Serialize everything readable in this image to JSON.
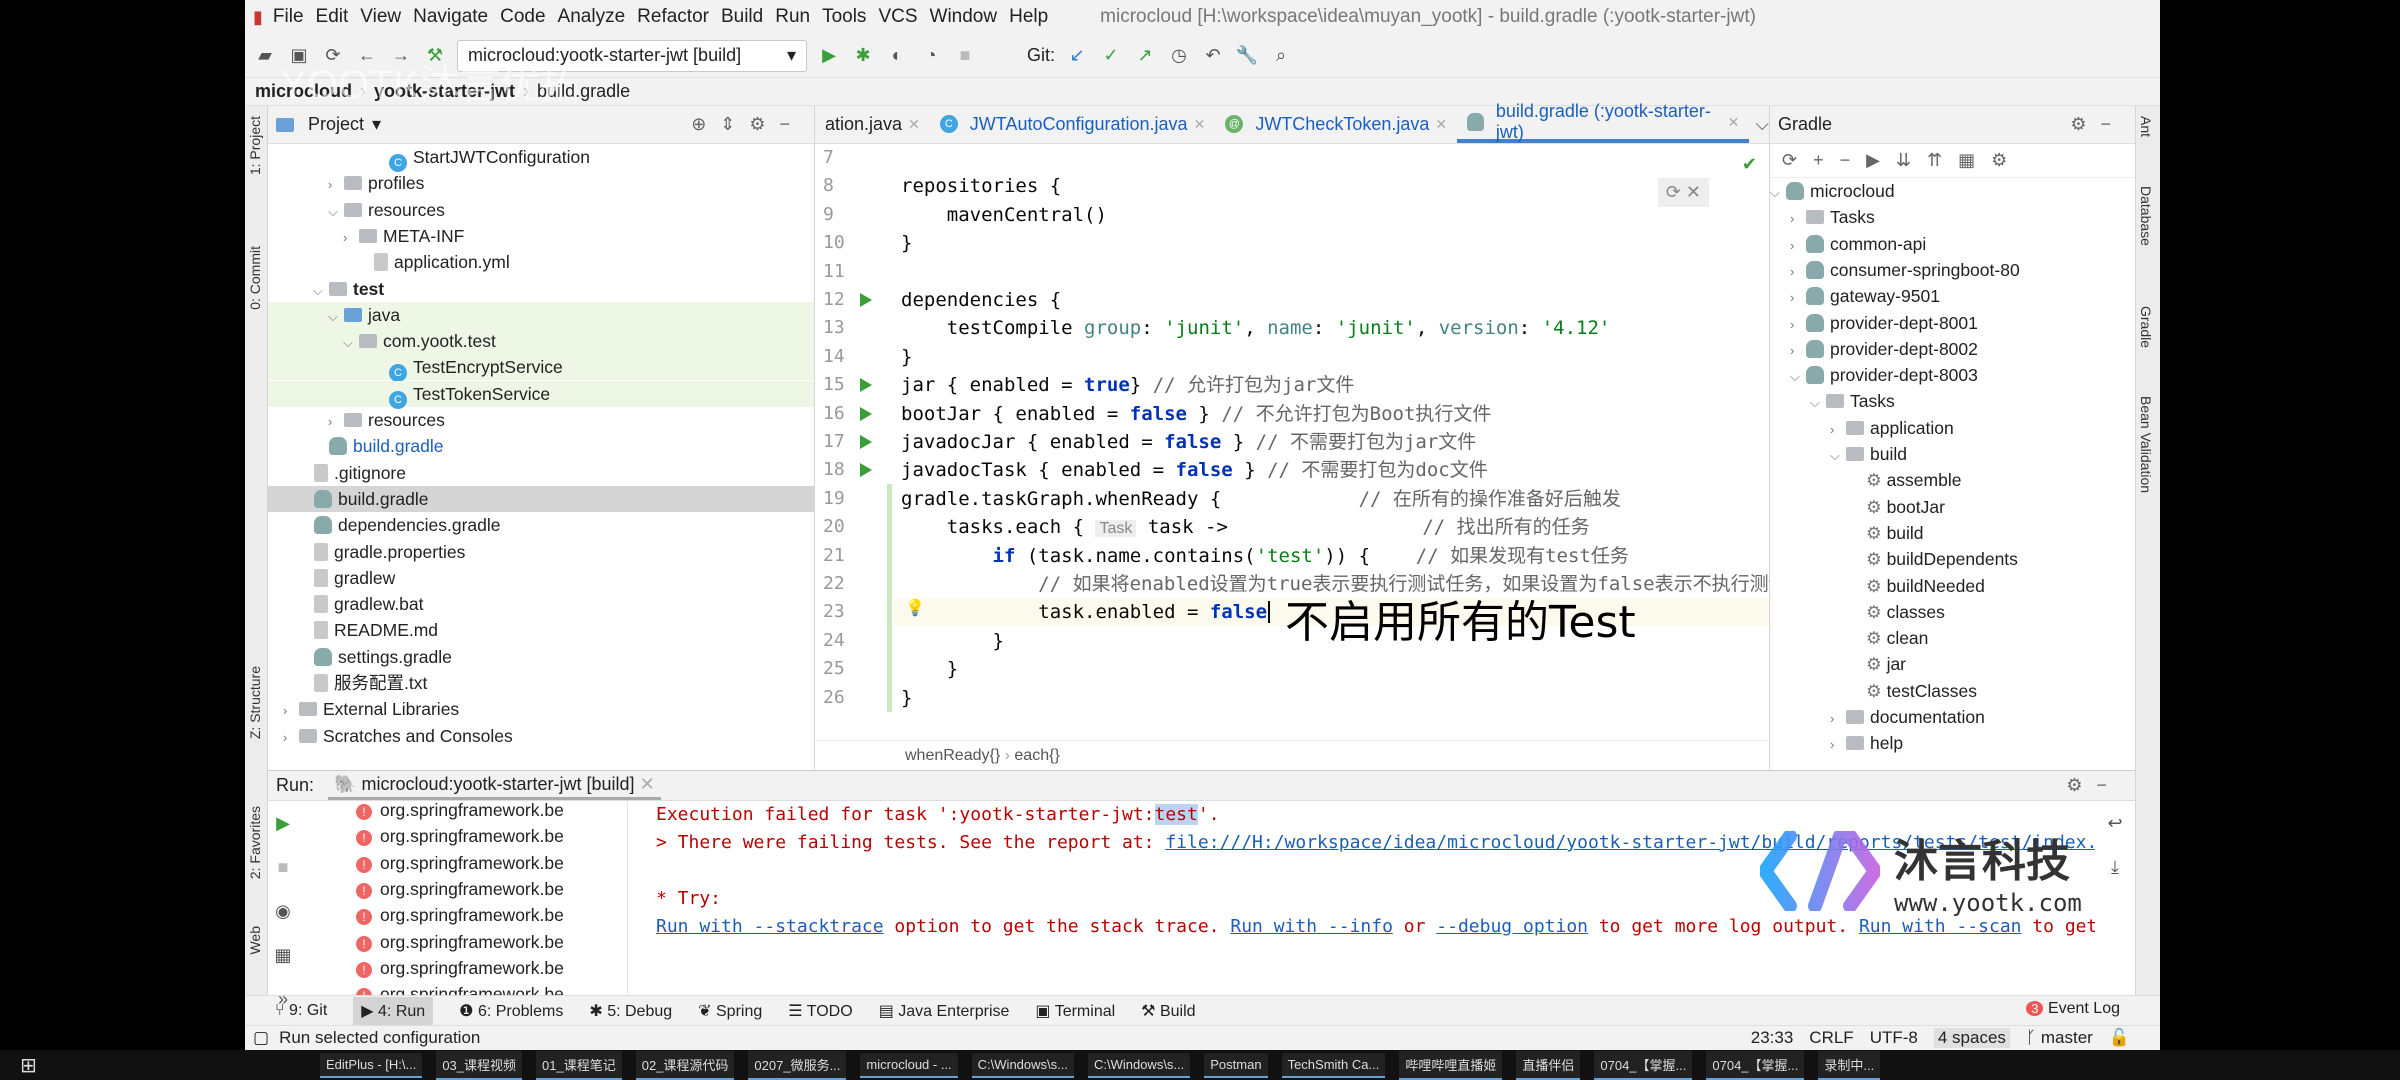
{
  "menu": {
    "items": [
      "File",
      "Edit",
      "View",
      "Navigate",
      "Code",
      "Analyze",
      "Refactor",
      "Build",
      "Run",
      "Tools",
      "VCS",
      "Window",
      "Help"
    ],
    "window_title": "microcloud [H:\\workspace\\idea\\muyan_yootk] - build.gradle (:yootk-starter-jwt)"
  },
  "toolbar": {
    "run_config": "microcloud:yootk-starter-jwt [build]",
    "git_label": "Git:"
  },
  "breadcrumb": [
    "microcloud",
    "yootk-starter-jwt",
    "build.gradle"
  ],
  "project": {
    "title": "Project",
    "rows": [
      {
        "label": "StartJWTConfiguration",
        "indent": 7,
        "icon": "class"
      },
      {
        "label": "profiles",
        "indent": 4,
        "icon": "folder",
        "arrow": "right"
      },
      {
        "label": "resources",
        "indent": 4,
        "icon": "folder",
        "arrow": "down"
      },
      {
        "label": "META-INF",
        "indent": 5,
        "icon": "folder",
        "arrow": "right"
      },
      {
        "label": "application.yml",
        "indent": 6,
        "icon": "file"
      },
      {
        "label": "test",
        "indent": 3,
        "icon": "folder",
        "arrow": "down",
        "bold": true
      },
      {
        "label": "java",
        "indent": 4,
        "icon": "src",
        "arrow": "down",
        "hl": true
      },
      {
        "label": "com.yootk.test",
        "indent": 5,
        "icon": "folder",
        "arrow": "down",
        "hl": true
      },
      {
        "label": "TestEncryptService",
        "indent": 7,
        "icon": "class",
        "hl": true
      },
      {
        "label": "TestTokenService",
        "indent": 7,
        "icon": "class",
        "hl": true
      },
      {
        "label": "resources",
        "indent": 4,
        "icon": "folder",
        "arrow": "right"
      },
      {
        "label": "build.gradle",
        "indent": 3,
        "icon": "gradle",
        "blue": true
      },
      {
        "label": ".gitignore",
        "indent": 2,
        "icon": "file"
      },
      {
        "label": "build.gradle",
        "indent": 2,
        "icon": "gradle",
        "selected": true
      },
      {
        "label": "dependencies.gradle",
        "indent": 2,
        "icon": "gradle"
      },
      {
        "label": "gradle.properties",
        "indent": 2,
        "icon": "file"
      },
      {
        "label": "gradlew",
        "indent": 2,
        "icon": "file"
      },
      {
        "label": "gradlew.bat",
        "indent": 2,
        "icon": "file"
      },
      {
        "label": "README.md",
        "indent": 2,
        "icon": "file"
      },
      {
        "label": "settings.gradle",
        "indent": 2,
        "icon": "gradle"
      },
      {
        "label": "服务配置.txt",
        "indent": 2,
        "icon": "file"
      },
      {
        "label": "External Libraries",
        "indent": 1,
        "icon": "folder",
        "arrow": "right"
      },
      {
        "label": "Scratches and Consoles",
        "indent": 1,
        "icon": "folder",
        "arrow": "right"
      }
    ]
  },
  "editor": {
    "tabs": [
      {
        "label": "ation.java"
      },
      {
        "label": "JWTAutoConfiguration.java"
      },
      {
        "label": "JWTCheckToken.java"
      },
      {
        "label": "build.gradle (:yootk-starter-jwt)",
        "active": true
      }
    ],
    "lines": [
      {
        "n": "7",
        "segs": []
      },
      {
        "n": "8",
        "segs": [
          [
            "t",
            "repositories {"
          ]
        ]
      },
      {
        "n": "9",
        "segs": [
          [
            "t",
            "    mavenCentral()"
          ]
        ]
      },
      {
        "n": "10",
        "segs": [
          [
            "t",
            "}"
          ]
        ]
      },
      {
        "n": "11",
        "segs": []
      },
      {
        "n": "12",
        "run": true,
        "segs": [
          [
            "t",
            "dependencies {"
          ]
        ]
      },
      {
        "n": "13",
        "segs": [
          [
            "t",
            "    testCompile "
          ],
          [
            "lab",
            "group"
          ],
          [
            "t",
            ": "
          ],
          [
            "str",
            "'junit'"
          ],
          [
            "t",
            ", "
          ],
          [
            "lab",
            "name"
          ],
          [
            "t",
            ": "
          ],
          [
            "str",
            "'junit'"
          ],
          [
            "t",
            ", "
          ],
          [
            "lab",
            "version"
          ],
          [
            "t",
            ": "
          ],
          [
            "str",
            "'4.12'"
          ]
        ]
      },
      {
        "n": "14",
        "segs": [
          [
            "t",
            "}"
          ]
        ]
      },
      {
        "n": "15",
        "run": true,
        "segs": [
          [
            "t",
            "jar { enabled = "
          ],
          [
            "kw",
            "true"
          ],
          [
            "t",
            "} "
          ],
          [
            "cm",
            "// 允许打包为jar文件"
          ]
        ]
      },
      {
        "n": "16",
        "run": true,
        "segs": [
          [
            "t",
            "bootJar { enabled = "
          ],
          [
            "kw",
            "false"
          ],
          [
            "t",
            " } "
          ],
          [
            "cm",
            "// 不允许打包为Boot执行文件"
          ]
        ]
      },
      {
        "n": "17",
        "run": true,
        "segs": [
          [
            "t",
            "javadocJar { enabled = "
          ],
          [
            "kw",
            "false"
          ],
          [
            "t",
            " } "
          ],
          [
            "cm",
            "// 不需要打包为jar文件"
          ]
        ]
      },
      {
        "n": "18",
        "run": true,
        "segs": [
          [
            "t",
            "javadocTask { enabled = "
          ],
          [
            "kw",
            "false"
          ],
          [
            "t",
            " } "
          ],
          [
            "cm",
            "// 不需要打包为doc文件"
          ]
        ]
      },
      {
        "n": "19",
        "segs": [
          [
            "t",
            "gradle.taskGraph.whenReady {            "
          ],
          [
            "cm",
            "// 在所有的操作准备好后触发"
          ]
        ]
      },
      {
        "n": "20",
        "segs": [
          [
            "t",
            "    tasks.each { "
          ],
          [
            "hint",
            "Task"
          ],
          [
            "t",
            " task ->                 "
          ],
          [
            "cm",
            "// 找出所有的任务"
          ]
        ]
      },
      {
        "n": "21",
        "segs": [
          [
            "t",
            "        "
          ],
          [
            "kw",
            "if"
          ],
          [
            "t",
            " (task.name.contains("
          ],
          [
            "str",
            "'test'"
          ],
          [
            "t",
            ")) {    "
          ],
          [
            "cm",
            "// 如果发现有test任务"
          ]
        ]
      },
      {
        "n": "22",
        "segs": [
          [
            "t",
            "            "
          ],
          [
            "cm",
            "// 如果将enabled设置为true表示要执行测试任务，如果设置为false表示不执行测试任务"
          ]
        ]
      },
      {
        "n": "23",
        "current": true,
        "segs": [
          [
            "t",
            "            task.enabled = "
          ],
          [
            "kw",
            "false"
          ]
        ]
      },
      {
        "n": "24",
        "segs": [
          [
            "t",
            "        }"
          ]
        ]
      },
      {
        "n": "25",
        "segs": [
          [
            "t",
            "    }"
          ]
        ]
      },
      {
        "n": "26",
        "segs": [
          [
            "t",
            "}"
          ]
        ]
      }
    ],
    "subtitle": "不启用所有的Test",
    "breadcrumb": [
      "whenReady{}",
      "each{}"
    ]
  },
  "gradle": {
    "title": "Gradle",
    "rows": [
      {
        "label": "microcloud",
        "indent": 0,
        "arrow": "down",
        "icon": "gradle"
      },
      {
        "label": "Tasks",
        "indent": 1,
        "arrow": "right",
        "icon": "folder"
      },
      {
        "label": "common-api",
        "indent": 1,
        "arrow": "right",
        "icon": "gradle"
      },
      {
        "label": "consumer-springboot-80",
        "indent": 1,
        "arrow": "right",
        "icon": "gradle"
      },
      {
        "label": "gateway-9501",
        "indent": 1,
        "arrow": "right",
        "icon": "gradle"
      },
      {
        "label": "provider-dept-8001",
        "indent": 1,
        "arrow": "right",
        "icon": "gradle"
      },
      {
        "label": "provider-dept-8002",
        "indent": 1,
        "arrow": "right",
        "icon": "gradle"
      },
      {
        "label": "provider-dept-8003",
        "indent": 1,
        "arrow": "down",
        "icon": "gradle"
      },
      {
        "label": "Tasks",
        "indent": 2,
        "arrow": "down",
        "icon": "folder"
      },
      {
        "label": "application",
        "indent": 3,
        "arrow": "right",
        "icon": "folder"
      },
      {
        "label": "build",
        "indent": 3,
        "arrow": "down",
        "icon": "folder"
      },
      {
        "label": "assemble",
        "indent": 4,
        "icon": "gear"
      },
      {
        "label": "bootJar",
        "indent": 4,
        "icon": "gear"
      },
      {
        "label": "build",
        "indent": 4,
        "icon": "gear"
      },
      {
        "label": "buildDependents",
        "indent": 4,
        "icon": "gear"
      },
      {
        "label": "buildNeeded",
        "indent": 4,
        "icon": "gear"
      },
      {
        "label": "classes",
        "indent": 4,
        "icon": "gear"
      },
      {
        "label": "clean",
        "indent": 4,
        "icon": "gear"
      },
      {
        "label": "jar",
        "indent": 4,
        "icon": "gear"
      },
      {
        "label": "testClasses",
        "indent": 4,
        "icon": "gear"
      },
      {
        "label": "documentation",
        "indent": 3,
        "arrow": "right",
        "icon": "folder"
      },
      {
        "label": "help",
        "indent": 3,
        "arrow": "right",
        "icon": "folder"
      }
    ]
  },
  "left_strip": [
    "1: Project",
    "0: Commit",
    "Z: Structure",
    "2: Favorites",
    "Web"
  ],
  "right_strip": [
    "Ant",
    "Database",
    "Gradle",
    "Bean Validation"
  ],
  "run": {
    "label": "Run:",
    "tab": "microcloud:yootk-starter-jwt [build]",
    "tree": [
      "org.springframework.be",
      "org.springframework.be",
      "org.springframework.be",
      "org.springframework.be",
      "org.springframework.be",
      "org.springframework.be",
      "org.springframework.be",
      "org.springframework.be"
    ],
    "console": {
      "line1_pre": "Execution failed for task ':yootk-starter-jwt:",
      "line1_sel": "test",
      "line1_post": "'.",
      "line2_pre": "> There were failing tests. See the report at: ",
      "line2_link": "file:///H:/workspace/idea/microcloud/yootk-starter-jwt/build/reports/tests/test/index.html",
      "try": "* Try:",
      "l4a": "Run with --stacktrace",
      "l4b": " option to get the stack trace. ",
      "l4c": "Run with --info",
      "l4d": " or ",
      "l4e": "--debug option",
      "l4f": " to get more log output. ",
      "l4g": "Run with --scan",
      "l4h": " to get full insights."
    }
  },
  "bottom_tools": [
    "9: Git",
    "4: Run",
    "6: Problems",
    "5: Debug",
    "Spring",
    "TODO",
    "Java Enterprise",
    "Terminal",
    "Build"
  ],
  "event_log": {
    "count": "3",
    "label": "Event Log"
  },
  "status": {
    "message": "Run selected configuration",
    "position": "23:33",
    "line_sep": "CRLF",
    "encoding": "UTF-8",
    "indent": "4 spaces",
    "branch": "master"
  },
  "watermark": {
    "brand": "沐言科技",
    "url": "www.yootk.com",
    "overlay": "YOOTK沐言优拓"
  },
  "taskbar": [
    "EditPlus - [H:\\...",
    "03_课程视频",
    "01_课程笔记",
    "02_课程源代码",
    "0207_微服务...",
    "microcloud - ...",
    "C:\\Windows\\s...",
    "C:\\Windows\\s...",
    "Postman",
    "TechSmith Ca...",
    "哔哩哔哩直播姬",
    "直播伴侣",
    "0704_【掌握...",
    "0704_【掌握...",
    "录制中..."
  ],
  "colors": {
    "accent": "#4083c9",
    "keyword": "#0033b3",
    "string": "#067d17",
    "error": "#b00000",
    "link": "#1a5fb4",
    "run": "#3a9e3a"
  }
}
